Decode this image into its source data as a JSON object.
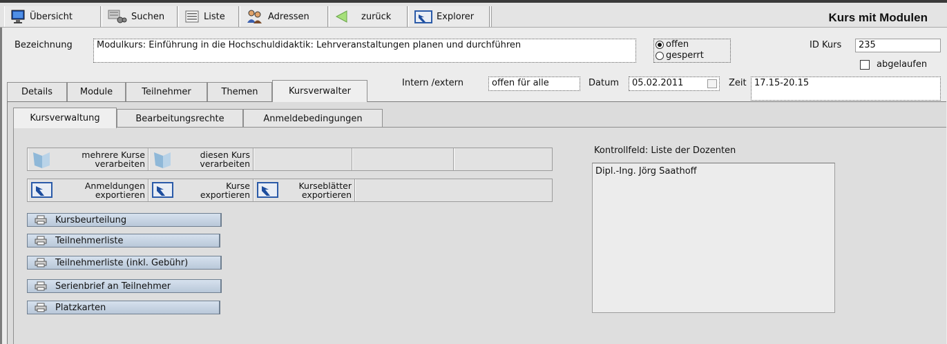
{
  "toolbar": {
    "items": [
      {
        "label": "Übersicht",
        "icon": "monitor-icon"
      },
      {
        "label": "Suchen",
        "icon": "search-icon"
      },
      {
        "label": "Liste",
        "icon": "list-icon"
      },
      {
        "label": "Adressen",
        "icon": "people-icon"
      },
      {
        "label": "zurück",
        "icon": "back-arrow-icon"
      },
      {
        "label": "Explorer",
        "icon": "explorer-icon"
      }
    ],
    "title": "Kurs mit Modulen"
  },
  "form": {
    "bezeichnung_label": "Bezeichnung",
    "bezeichnung_value": "Modulkurs: Einführung in die Hochschuldidaktik: Lehrveranstaltungen planen und durchführen",
    "status_options": [
      "offen",
      "gesperrt"
    ],
    "status_selected": "offen",
    "id_label": "ID Kurs",
    "id_value": "235",
    "abgelaufen_label": "abgelaufen",
    "abgelaufen_checked": false,
    "intern_label": "Intern /extern",
    "intern_value": "offen für alle",
    "datum_label": "Datum",
    "datum_value": "05.02.2011",
    "zeit_label": "Zeit",
    "zeit_value": "17.15-20.15"
  },
  "tabs": [
    "Details",
    "Module",
    "Teilnehmer",
    "Themen",
    "Kursverwalter"
  ],
  "active_tab": "Kursverwalter",
  "subtabs": [
    "Kursverwaltung",
    "Bearbeitungsrechte",
    "Anmeldebedingungen"
  ],
  "active_subtab": "Kursverwaltung",
  "actions": {
    "row1": [
      {
        "line1": "mehrere Kurse",
        "line2": "verarbeiten"
      },
      {
        "line1": "diesen Kurs",
        "line2": "verarbeiten"
      }
    ],
    "row2": [
      {
        "line1": "Anmeldungen",
        "line2": "exportieren"
      },
      {
        "line1": "Kurse",
        "line2": "exportieren"
      },
      {
        "line1": "Kurseblätter",
        "line2": "exportieren"
      }
    ],
    "print_buttons": [
      "Kursbeurteilung",
      "Teilnehmerliste",
      "Teilnehmerliste (inkl. Gebühr)",
      "Serienbrief an Teilnehmer",
      "Platzkarten"
    ]
  },
  "kontrollfeld": {
    "label": "Kontrollfeld: Liste der Dozenten",
    "items": [
      "Dipl.-Ing. Jörg Saathoff"
    ]
  },
  "colors": {
    "print_button": "#c3d0df",
    "toolbar_border": "#3a3a3a"
  }
}
